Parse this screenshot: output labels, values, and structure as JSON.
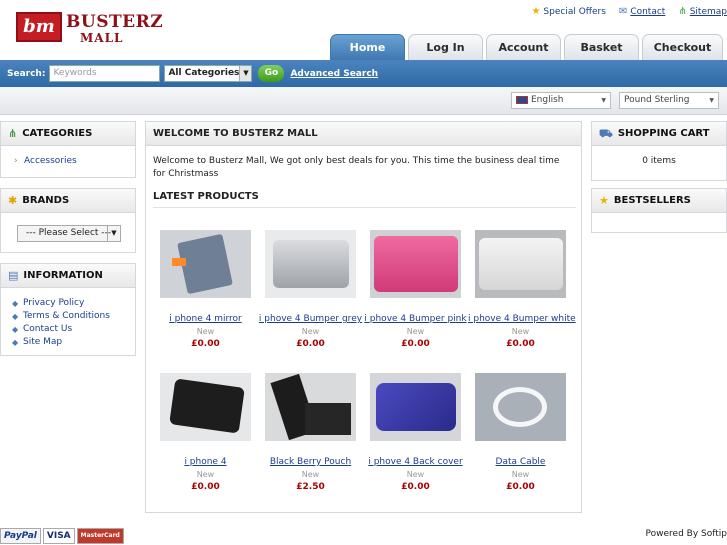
{
  "logo": {
    "mark": "bm",
    "line1": "BUSTERZ",
    "line2": "MALL"
  },
  "toplinks": [
    {
      "icon": "star-icon",
      "label": "Special Offers"
    },
    {
      "icon": "mail-icon",
      "label": "Contact"
    },
    {
      "icon": "sitemap-icon",
      "label": "Sitemap"
    }
  ],
  "tabs": [
    "Home",
    "Log In",
    "Account",
    "Basket",
    "Checkout"
  ],
  "search": {
    "label": "Search:",
    "placeholder": "Keywords",
    "category": "All Categories",
    "go": "Go",
    "advanced": "Advanced Search"
  },
  "subbar": {
    "language": "English",
    "currency": "Pound Sterling"
  },
  "left": {
    "categories": {
      "title": "CATEGORIES",
      "items": [
        "Accessories"
      ]
    },
    "brands": {
      "title": "BRANDS",
      "select": "--- Please Select ---"
    },
    "information": {
      "title": "INFORMATION",
      "items": [
        "Privacy Policy",
        "Terms & Conditions",
        "Contact Us",
        "Site Map"
      ]
    }
  },
  "main": {
    "title": "WELCOME TO BUSTERZ MALL",
    "welcome": "Welcome to Busterz Mall, We got only best deals for you. This time the business deal time for Christmass",
    "latest": "LATEST PRODUCTS",
    "products": [
      {
        "name": "i phone 4 mirror",
        "cond": "New",
        "price": "£0.00",
        "color": "#6e7f96"
      },
      {
        "name": "i phove 4 Bumper grey",
        "cond": "New",
        "price": "£0.00",
        "color": "#b8bbc0"
      },
      {
        "name": "i phove 4 Bumper pink",
        "cond": "New",
        "price": "£0.00",
        "color": "#e0508a"
      },
      {
        "name": "i phove 4 Bumper white",
        "cond": "New",
        "price": "£0.00",
        "color": "#e4e4e4"
      },
      {
        "name": "i phone 4",
        "cond": "New",
        "price": "£0.00",
        "color": "#222222"
      },
      {
        "name": "Black Berry Pouch",
        "cond": "New",
        "price": "£2.50",
        "color": "#1c1c1c"
      },
      {
        "name": "i phove 4 Back cover",
        "cond": "New",
        "price": "£0.00",
        "color": "#3b3aa8"
      },
      {
        "name": "Data Cable",
        "cond": "New",
        "price": "£0.00",
        "color": "#dfe4ea"
      }
    ]
  },
  "right": {
    "cart": {
      "title": "SHOPPING CART",
      "text": "0 items"
    },
    "best": {
      "title": "BESTSELLERS"
    }
  },
  "footer": {
    "powered": "Powered By Softip",
    "payments": [
      "PayPal",
      "VISA",
      "MasterCard"
    ]
  }
}
